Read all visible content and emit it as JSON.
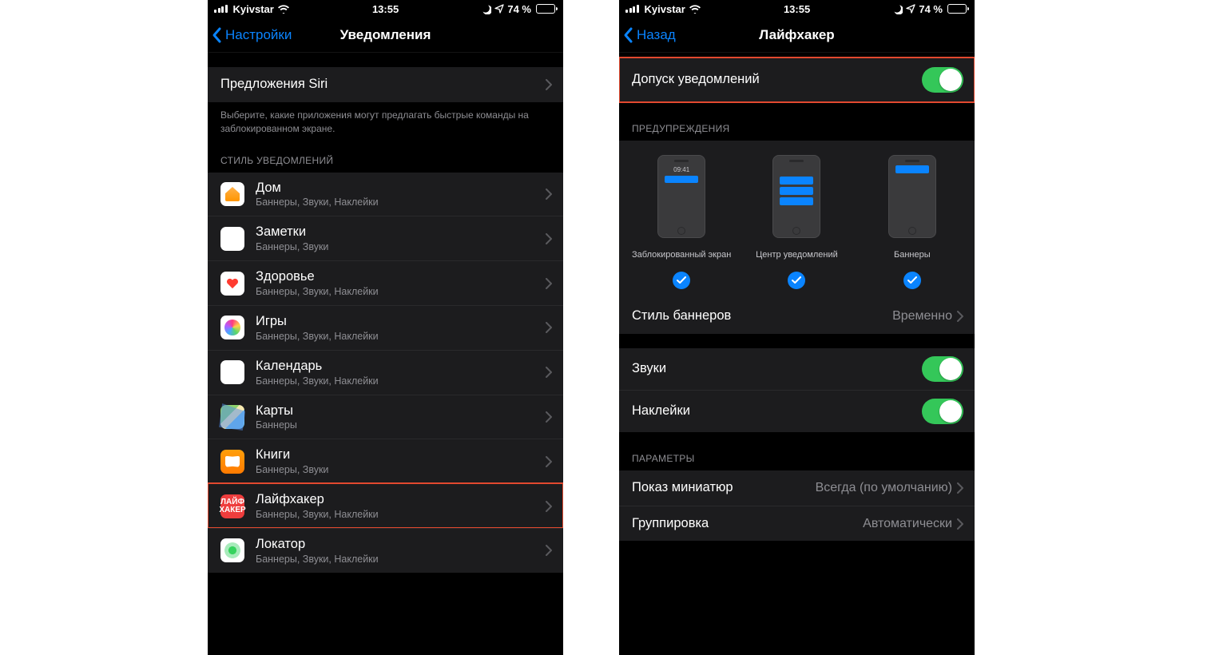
{
  "status": {
    "carrier": "Kyivstar",
    "time": "13:55",
    "battery_pct": "74 %"
  },
  "left_screen": {
    "back_label": "Настройки",
    "title": "Уведомления",
    "siri_cell": "Предложения Siri",
    "siri_footer": "Выберите, какие приложения могут предлагать быстрые команды на заблокированном экране.",
    "style_header": "СТИЛЬ УВЕДОМЛЕНИЙ",
    "apps": [
      {
        "name": "Дом",
        "sub": "Баннеры, Звуки, Наклейки",
        "icon": "home"
      },
      {
        "name": "Заметки",
        "sub": "Баннеры, Звуки",
        "icon": "notes"
      },
      {
        "name": "Здоровье",
        "sub": "Баннеры, Звуки, Наклейки",
        "icon": "health"
      },
      {
        "name": "Игры",
        "sub": "Баннеры, Звуки, Наклейки",
        "icon": "games"
      },
      {
        "name": "Календарь",
        "sub": "Баннеры, Звуки, Наклейки",
        "icon": "cal"
      },
      {
        "name": "Карты",
        "sub": "Баннеры",
        "icon": "maps"
      },
      {
        "name": "Книги",
        "sub": "Баннеры, Звуки",
        "icon": "books"
      },
      {
        "name": "Лайфхакер",
        "sub": "Баннеры, Звуки, Наклейки",
        "icon": "lh",
        "highlight": true,
        "lh_text": "ЛАЙФ\nХАКЕР"
      },
      {
        "name": "Локатор",
        "sub": "Баннеры, Звуки, Наклейки",
        "icon": "findmy"
      }
    ]
  },
  "right_screen": {
    "back_label": "Назад",
    "title": "Лайфхакер",
    "allow_label": "Допуск уведомлений",
    "alerts_header": "ПРЕДУПРЕЖДЕНИЯ",
    "preview_lock": "Заблокированный экран",
    "preview_nc": "Центр уведомлений",
    "preview_banners": "Баннеры",
    "lock_time": "09:41",
    "banner_style_label": "Стиль баннеров",
    "banner_style_value": "Временно",
    "sounds_label": "Звуки",
    "badges_label": "Наклейки",
    "options_header": "ПАРАМЕТРЫ",
    "previews_label": "Показ миниатюр",
    "previews_value": "Всегда (по умолчанию)",
    "grouping_label": "Группировка",
    "grouping_value": "Автоматически"
  }
}
